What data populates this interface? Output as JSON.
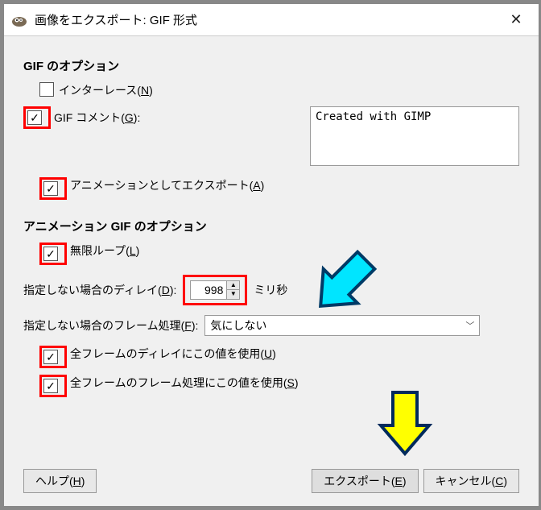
{
  "titlebar": {
    "title": "画像をエクスポート: GIF 形式"
  },
  "section1_title": "GIF のオプション",
  "interlace_label": "インターレース(N)",
  "comment_label": "GIF コメント(G):",
  "comment_value": "Created with GIMP",
  "animation_export_label": "アニメーションとしてエクスポート(A)",
  "section2_title": "アニメーション GIF のオプション",
  "loop_label": "無限ループ(L)",
  "delay_label": "指定しない場合のディレイ(D):",
  "delay_value": "998",
  "delay_unit": "ミリ秒",
  "frame_proc_label": "指定しない場合のフレーム処理(F):",
  "frame_proc_value": "気にしない",
  "use_delay_all_label": "全フレームのディレイにこの値を使用(U)",
  "use_proc_all_label": "全フレームのフレーム処理にこの値を使用(S)",
  "help_label": "ヘルプ(H)",
  "export_label": "エクスポート(E)",
  "cancel_label": "キャンセル(C)",
  "checkboxes": {
    "interlace": false,
    "comment": true,
    "animation": true,
    "loop": true,
    "use_delay_all": true,
    "use_proc_all": true
  }
}
